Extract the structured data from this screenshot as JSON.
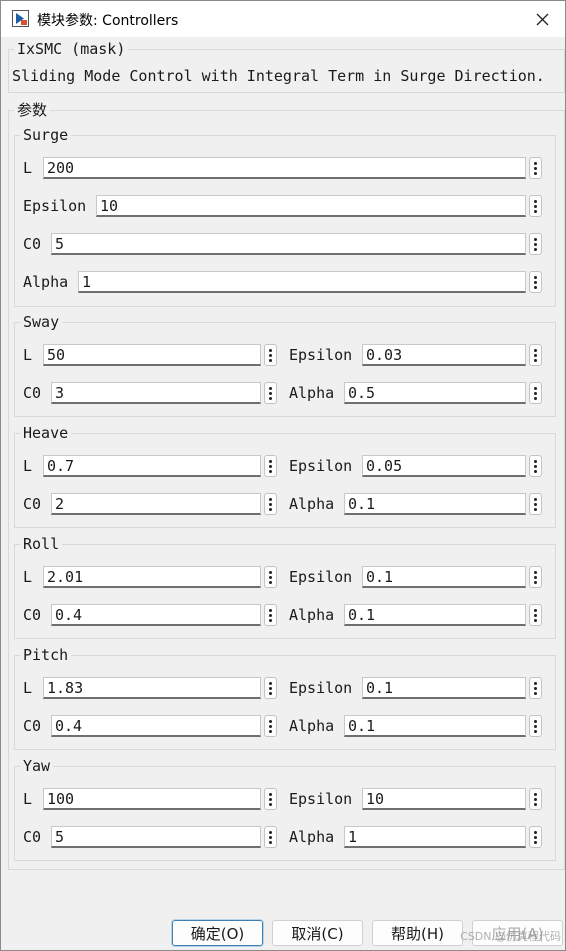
{
  "window": {
    "title": "模块参数: Controllers",
    "app_icon": "simulink-block-icon",
    "close_icon": "close-icon"
  },
  "mask": {
    "legend": "IxSMC (mask)",
    "description": "Sliding Mode Control with Integral Term in Surge Direction."
  },
  "params_legend": "参数",
  "surge": {
    "legend": "Surge",
    "rows": [
      {
        "label": "L",
        "value": "200"
      },
      {
        "label": "Epsilon",
        "value": "10"
      },
      {
        "label": "C0",
        "value": "5"
      },
      {
        "label": "Alpha",
        "value": "1"
      }
    ]
  },
  "groups": [
    {
      "legend": "Sway",
      "L": "50",
      "Epsilon": "0.03",
      "C0": "3",
      "Alpha": "0.5"
    },
    {
      "legend": "Heave",
      "L": "0.7",
      "Epsilon": "0.05",
      "C0": "2",
      "Alpha": "0.1"
    },
    {
      "legend": "Roll",
      "L": "2.01",
      "Epsilon": "0.1",
      "C0": "0.4",
      "Alpha": "0.1"
    },
    {
      "legend": "Pitch",
      "L": "1.83",
      "Epsilon": "0.1",
      "C0": "0.4",
      "Alpha": "0.1"
    },
    {
      "legend": "Yaw",
      "L": "100",
      "Epsilon": "10",
      "C0": "5",
      "Alpha": "1"
    }
  ],
  "labels": {
    "L": "L",
    "Epsilon": "Epsilon",
    "C0": "C0",
    "Alpha": "Alpha"
  },
  "more_icon": "more-options-icon",
  "buttons": {
    "ok": "确定(O)",
    "cancel": "取消(C)",
    "help": "帮助(H)",
    "apply": "应用(A)"
  },
  "watermark": "CSDN @仿真程代码"
}
